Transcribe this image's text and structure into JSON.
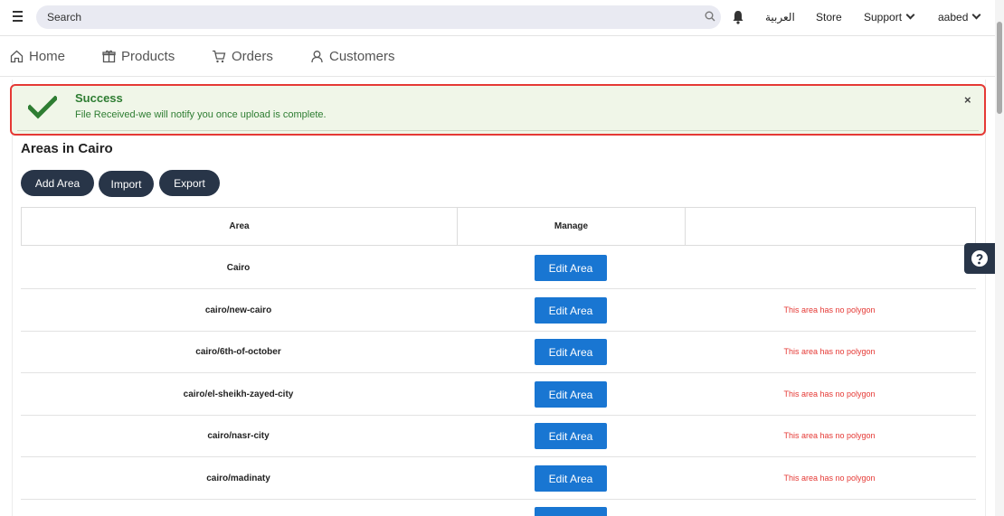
{
  "topbar": {
    "search_placeholder": "Search",
    "arabic_label": "العربية",
    "store_label": "Store",
    "support_label": "Support",
    "user_label": "aabed"
  },
  "tabs": [
    {
      "label": "Home",
      "icon": "home-icon"
    },
    {
      "label": "Products",
      "icon": "box-icon"
    },
    {
      "label": "Orders",
      "icon": "cart-icon"
    },
    {
      "label": "Customers",
      "icon": "user-icon"
    }
  ],
  "alert": {
    "title": "Success",
    "message": "File Received-we will notify you once upload is complete.",
    "close": "×"
  },
  "page": {
    "title": "Areas in Cairo",
    "add_label": "Add Area",
    "import_label": "Import",
    "export_label": "Export"
  },
  "table": {
    "headers": [
      "Area",
      "Manage",
      ""
    ],
    "edit_label": "Edit Area",
    "rows": [
      {
        "area": "Cairo",
        "note": ""
      },
      {
        "area": "cairo/new-cairo",
        "note": "This area has no polygon"
      },
      {
        "area": "cairo/6th-of-october",
        "note": "This area has no polygon"
      },
      {
        "area": "cairo/el-sheikh-zayed-city",
        "note": "This area has no polygon"
      },
      {
        "area": "cairo/nasr-city",
        "note": "This area has no polygon"
      },
      {
        "area": "cairo/madinaty",
        "note": "This area has no polygon"
      },
      {
        "area": "",
        "note": ""
      }
    ]
  },
  "colors": {
    "primary_dark": "#283548",
    "edit_blue": "#1976d2",
    "success_green": "#2e7d32",
    "alert_border": "#e53935",
    "warning_red": "#e53935"
  }
}
